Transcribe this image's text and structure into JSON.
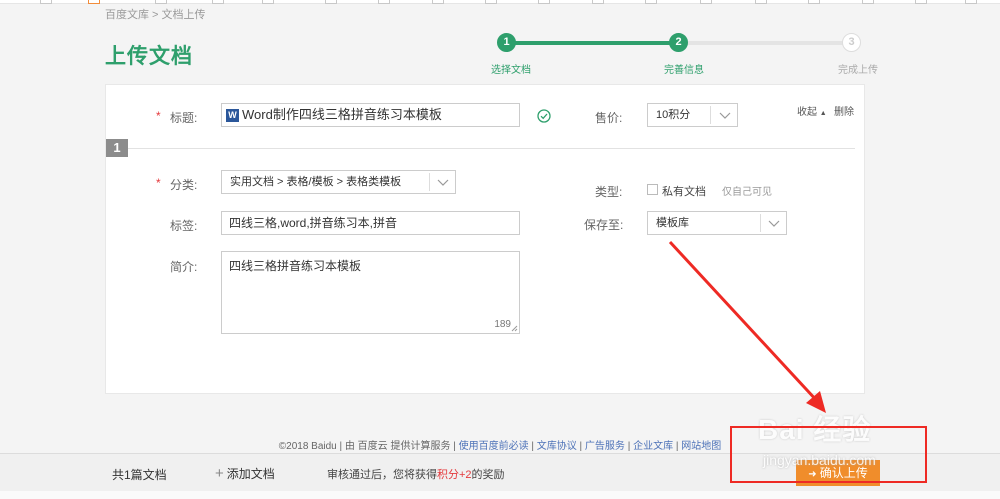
{
  "breadcrumb": "百度文库 > 文档上传",
  "page_title": "上传文档",
  "steps": [
    {
      "num": "1",
      "label": "选择文档",
      "state": "done"
    },
    {
      "num": "2",
      "label": "完善信息",
      "state": "active"
    },
    {
      "num": "3",
      "label": "完成上传",
      "state": "pending"
    }
  ],
  "doc_index": "1",
  "form": {
    "title_label": "标题:",
    "title_value": "Word制作四线三格拼音练习本模板",
    "title_file_icon": "W",
    "price_label": "售价:",
    "price_value": "10积分",
    "collapse_label": "收起",
    "delete_label": "删除",
    "category_label": "分类:",
    "category_value": "实用文档 > 表格/模板 > 表格类模板",
    "type_label": "类型:",
    "private_label": "私有文档",
    "private_hint": "仅自己可见",
    "tags_label": "标签:",
    "tags_value": "四线三格,word,拼音练习本,拼音",
    "save_label": "保存至:",
    "save_value": "模板库",
    "intro_label": "简介:",
    "intro_value": "四线三格拼音练习本模板",
    "intro_remaining": "189",
    "required_mark": "*"
  },
  "footer": {
    "copyright": "©2018 Baidu",
    "provider": "由 百度云 提供计算服务",
    "links": [
      "使用百度前必读",
      "文库协议",
      "广告服务",
      "企业文库",
      "网站地图"
    ]
  },
  "bottom_bar": {
    "doc_count": "共1篇文档",
    "add_doc": "添加文档",
    "reward_prefix": "审核通过后，您将获得",
    "reward_points": "积分+2",
    "reward_suffix": "的奖励",
    "confirm": "确认上传"
  },
  "watermark": {
    "main": "Bai 经验",
    "sub": "jingyan.baidu.com"
  },
  "colors": {
    "accent": "#2e9f6c",
    "confirm": "#f08d2b",
    "annotation": "#ee2a24",
    "link": "#4d72b8"
  }
}
